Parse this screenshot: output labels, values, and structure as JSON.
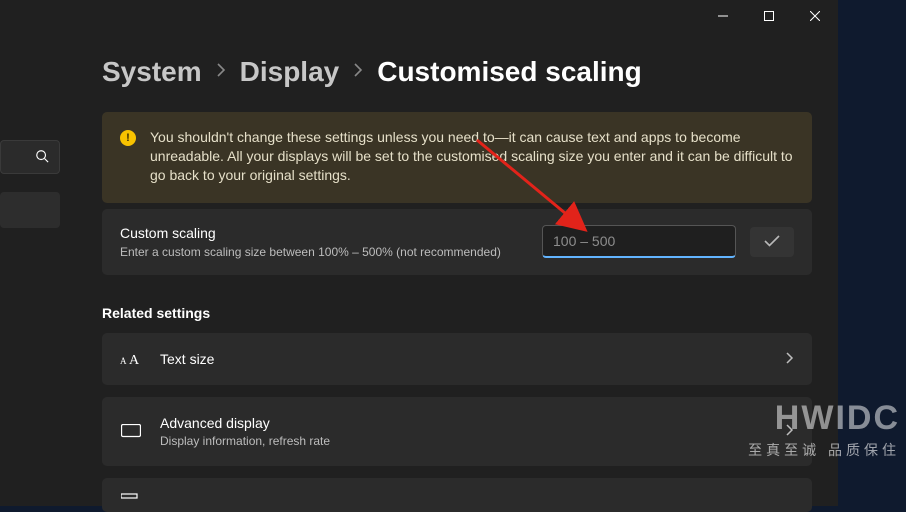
{
  "breadcrumbs": {
    "level1": "System",
    "level2": "Display",
    "current": "Customised scaling"
  },
  "warning": {
    "text": "You shouldn't change these settings unless you need to—it can cause text and apps to become unreadable. All your displays will be set to the customised scaling size you enter and it can be difficult to go back to your original settings."
  },
  "custom_scaling": {
    "title": "Custom scaling",
    "subtitle": "Enter a custom scaling size between 100% – 500% (not recommended)",
    "placeholder": "100 – 500",
    "value": ""
  },
  "related": {
    "heading": "Related settings",
    "items": [
      {
        "title": "Text size",
        "sub": ""
      },
      {
        "title": "Advanced display",
        "sub": "Display information, refresh rate"
      }
    ]
  },
  "watermark": {
    "brand": "HWIDC",
    "tagline": "至真至诚  品质保住"
  }
}
